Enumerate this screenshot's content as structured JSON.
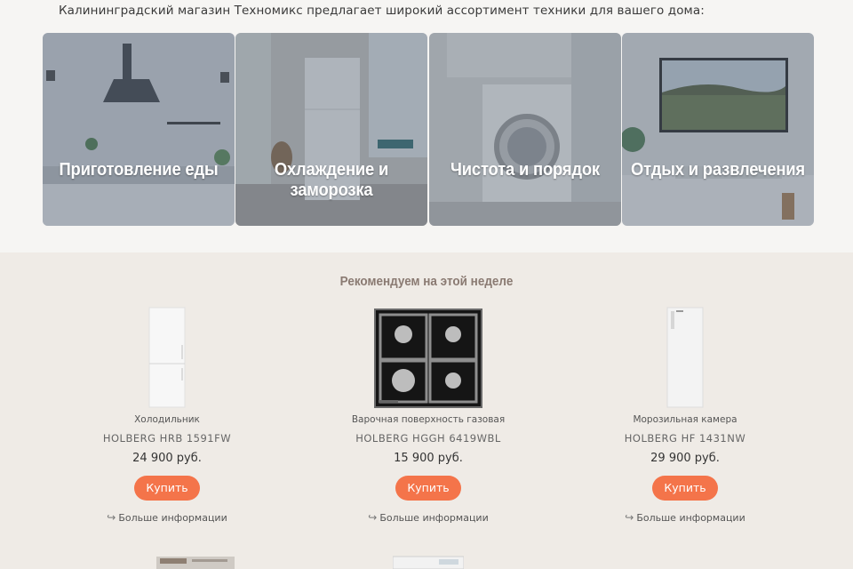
{
  "intro_text": "Калининградский магазин Техномикс предлагает широкий ассортимент техники для вашего дома:",
  "categories": [
    {
      "label": "Приготовление еды"
    },
    {
      "label": "Охлаждение и заморозка"
    },
    {
      "label": "Чистота и порядок"
    },
    {
      "label": "Отдых и развлечения"
    }
  ],
  "recommended": {
    "title": "Рекомендуем на этой неделе",
    "products": [
      {
        "type": "Холодильник",
        "model": "HOLBERG HRB 1591FW",
        "price": "24 900 руб.",
        "buy": "Купить",
        "more": "Больше информации",
        "icon": "return-arrow-icon"
      },
      {
        "type": "Варочная поверхность газовая",
        "model": "HOLBERG HGGH 6419WBL",
        "price": "15 900 руб.",
        "buy": "Купить",
        "more": "Больше информации",
        "icon": "return-arrow-icon"
      },
      {
        "type": "Морозильная камера",
        "model": "HOLBERG HF 1431NW",
        "price": "29 900 руб.",
        "buy": "Купить",
        "more": "Больше информации",
        "icon": "return-arrow-icon"
      }
    ]
  },
  "colors": {
    "accent": "#f4744a",
    "section_bg": "#efebe6",
    "title": "#8a7a72"
  }
}
